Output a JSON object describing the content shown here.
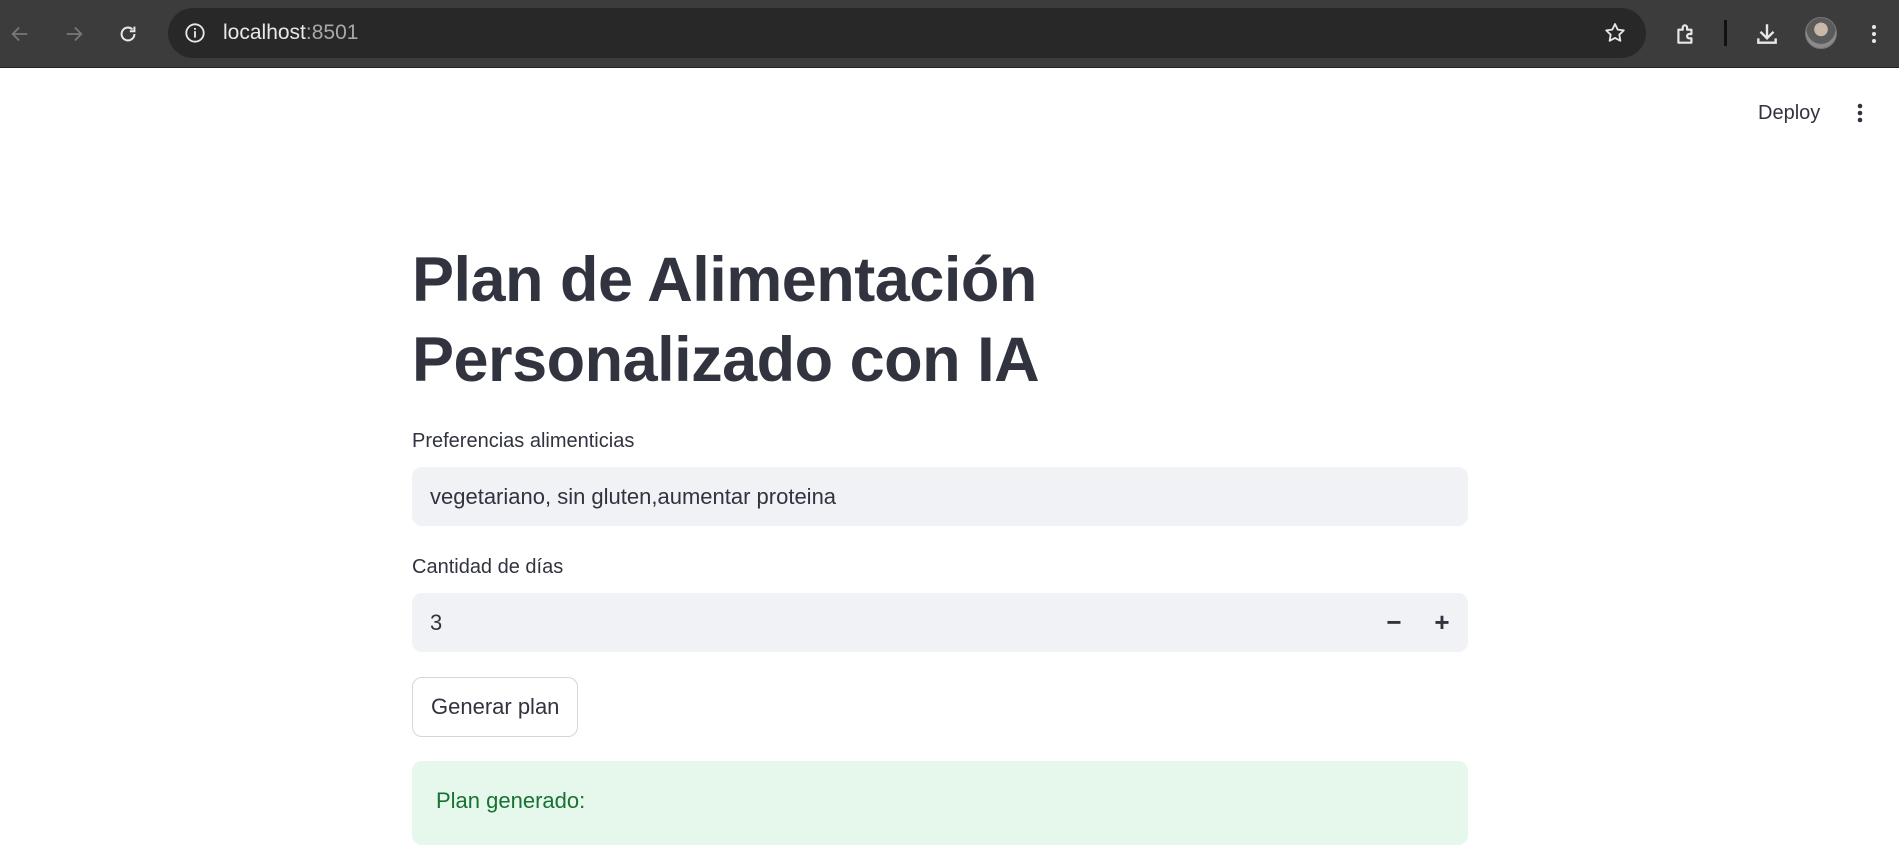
{
  "browser": {
    "url_host": "localhost",
    "url_port": ":8501",
    "icons": [
      "back-icon",
      "forward-icon",
      "reload-icon",
      "site-info-icon",
      "bookmark-star-icon",
      "extensions-icon",
      "download-icon",
      "profile-avatar",
      "browser-menu-icon"
    ]
  },
  "app_header": {
    "deploy_label": "Deploy",
    "menu_icon": "vertical-dots-icon"
  },
  "main": {
    "title": "Plan de Alimentación Personalizado con IA",
    "preferences": {
      "label": "Preferencias alimenticias",
      "value": "vegetariano, sin gluten,aumentar proteina"
    },
    "days": {
      "label": "Cantidad de días",
      "value": "3",
      "decrement_symbol": "−",
      "increment_symbol": "+"
    },
    "generate_button_label": "Generar plan",
    "success": {
      "text": "Plan generado:"
    }
  },
  "colors": {
    "browser_bar": "#3c3c3c",
    "text": "#31333f",
    "input_bg": "#f0f2f6",
    "success_bg": "#e6f7ec",
    "success_text": "#177233"
  }
}
